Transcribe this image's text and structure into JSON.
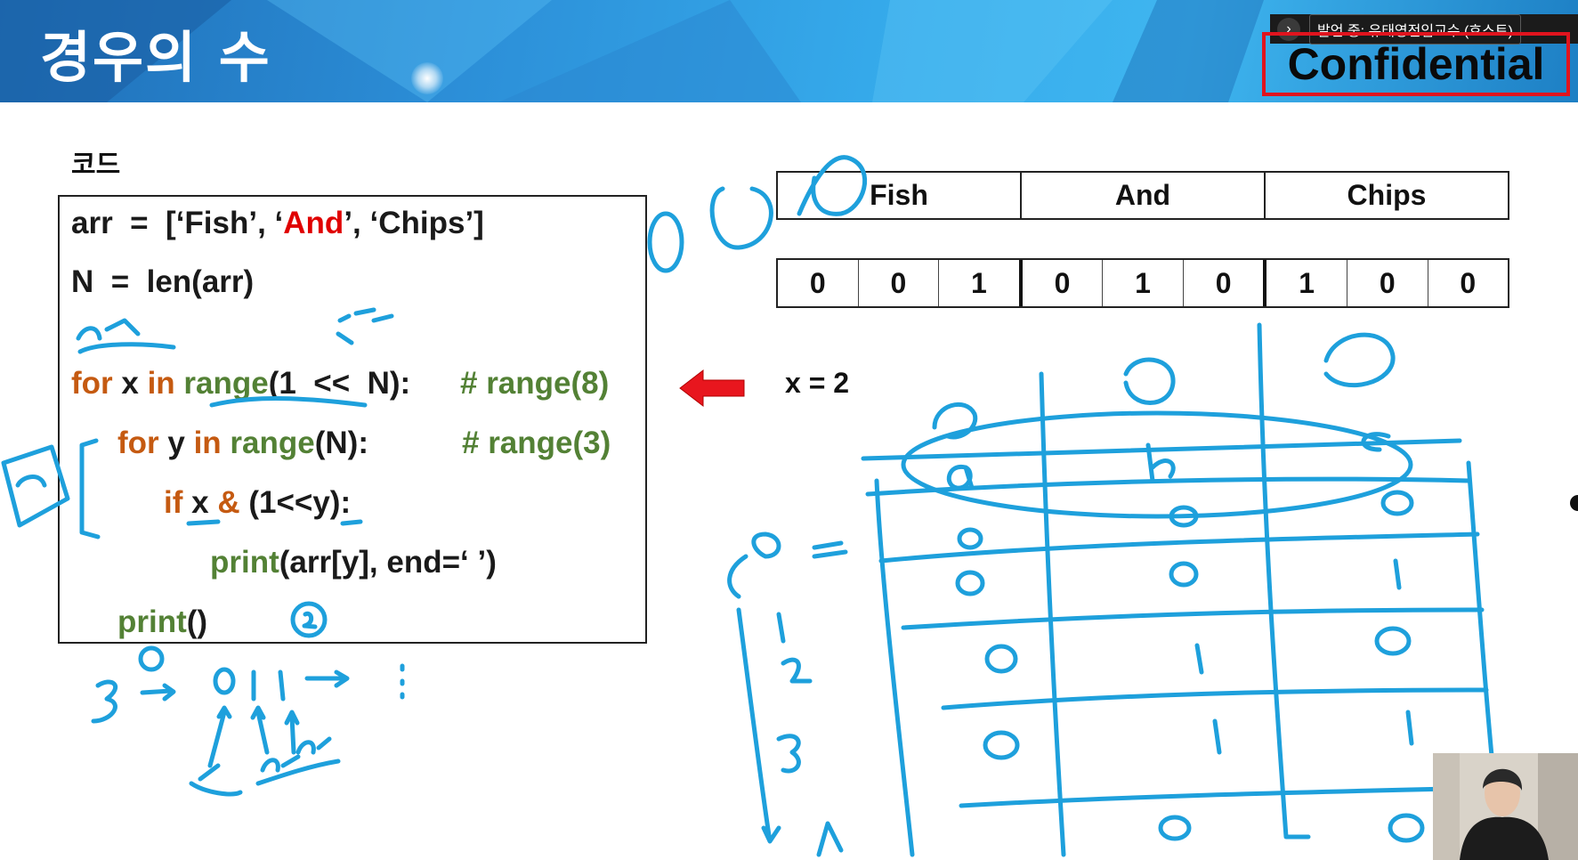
{
  "slide": {
    "title": "경우의 수",
    "code_label": "코드",
    "confidential": "Confidential"
  },
  "speaker_bar": {
    "text": "발언 중: 유태영전임교수 (호스트)"
  },
  "code": {
    "line1": {
      "pre": "arr  =  [‘Fish’, ‘",
      "red": "And",
      "post": "’, ‘Chips’]"
    },
    "line2": "N  =  len(arr)",
    "line3": {
      "kw1": "for",
      "var": " x ",
      "kw2": "in",
      "sp": " ",
      "fn": "range",
      "args": "(1  <<  N):",
      "comment": "# range(8)"
    },
    "line4": {
      "kw1": "for",
      "var": " y ",
      "kw2": "in",
      "sp": " ",
      "fn": "range",
      "args": "(N):",
      "comment": "# range(3)"
    },
    "line5": {
      "kw": "if",
      "mid": " x ",
      "amp": "&",
      "rest": " (1<<y):"
    },
    "line6": {
      "fn": "print",
      "args": "(arr[y], end=‘ ’)"
    },
    "line7": {
      "fn": "print",
      "args": "()"
    }
  },
  "word_table": [
    "Fish",
    "And",
    "Chips"
  ],
  "bit_table": [
    "0",
    "0",
    "1",
    "0",
    "1",
    "0",
    "1",
    "0",
    "0"
  ],
  "x_value_text": "x  =  2",
  "colors": {
    "keyword": "#c55a11",
    "function": "#538135",
    "highlight_red": "#e00000",
    "ink": "#1ea0dc",
    "banner": "#2c8fd8"
  }
}
